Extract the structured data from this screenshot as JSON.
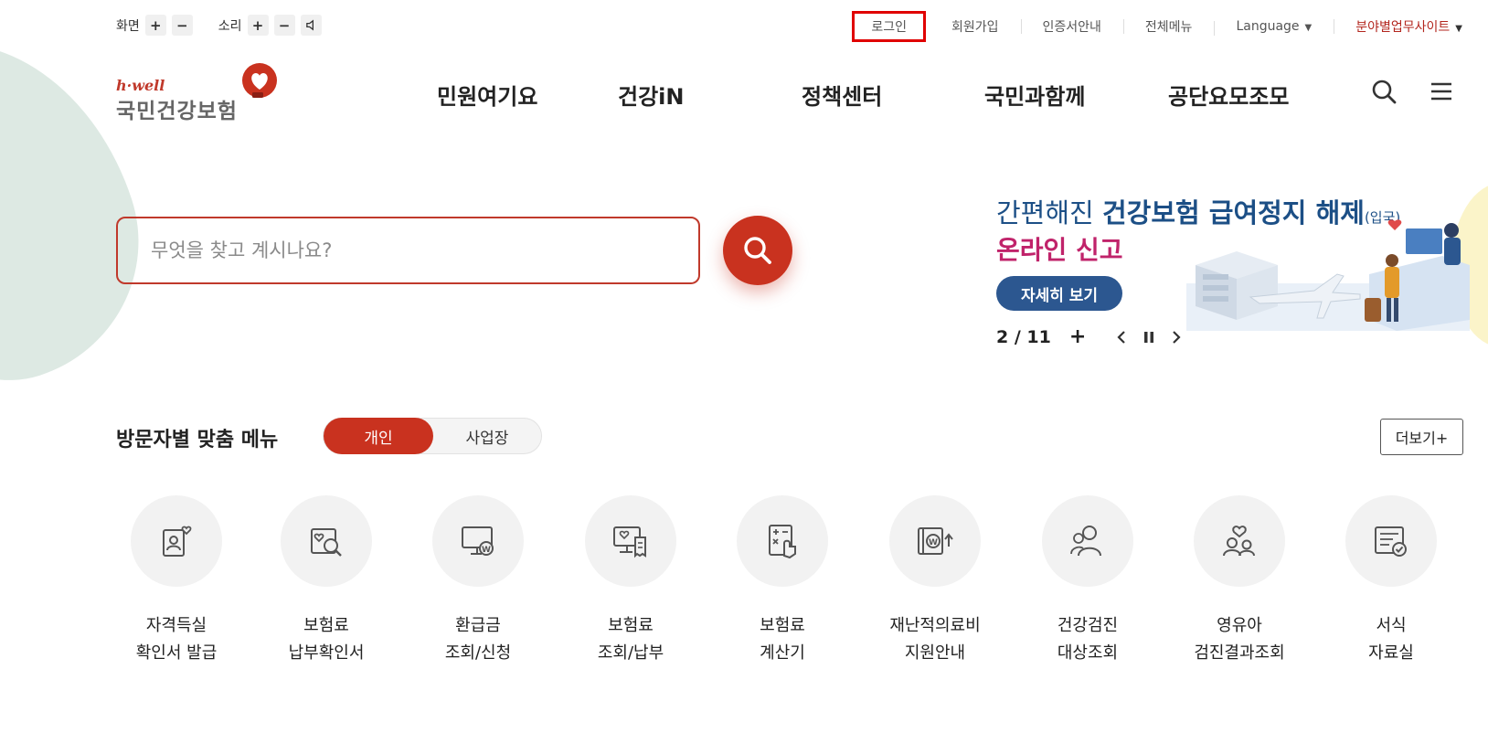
{
  "utility": {
    "screen_label": "화면",
    "sound_label": "소리",
    "plus": "+",
    "minus": "−",
    "links": {
      "login": "로그인",
      "signup": "회원가입",
      "cert": "인증서안내",
      "all_menu": "전체메뉴",
      "language": "Language",
      "field_sites": "분야별업무사이트"
    }
  },
  "logo": {
    "tagline": "h·well",
    "name": "국민건강보험"
  },
  "nav": {
    "items": [
      "민원여기요",
      "건강iN",
      "정책센터",
      "국민과함께",
      "공단요모조모"
    ]
  },
  "search": {
    "placeholder": "무엇을 찾고 계시나요?"
  },
  "banner": {
    "line1_light": "간편해진 ",
    "line1_bold": "건강보험 급여정지 해제",
    "line1_small": "(입국)",
    "line2": "온라인 신고",
    "button": "자세히 보기",
    "counter": "2 / 11",
    "plus": "+"
  },
  "visitor_menu": {
    "title": "방문자별 맞춤 메뉴",
    "tab_personal": "개인",
    "tab_business": "사업장",
    "more": "더보기+",
    "items": [
      {
        "line1": "자격득실",
        "line2": "확인서 발급",
        "icon": "certificate-heart-icon"
      },
      {
        "line1": "보험료",
        "line2": "납부확인서",
        "icon": "document-search-icon"
      },
      {
        "line1": "환급금",
        "line2": "조회/신청",
        "icon": "monitor-won-icon"
      },
      {
        "line1": "보험료",
        "line2": "조회/납부",
        "icon": "monitor-receipt-icon"
      },
      {
        "line1": "보험료",
        "line2": "계산기",
        "icon": "calculator-hand-icon"
      },
      {
        "line1": "재난적의료비",
        "line2": "지원안내",
        "icon": "won-card-arrow-icon"
      },
      {
        "line1": "건강검진",
        "line2": "대상조회",
        "icon": "people-group-icon"
      },
      {
        "line1": "영유아",
        "line2": "검진결과조회",
        "icon": "family-heart-icon"
      },
      {
        "line1": "서식",
        "line2": "자료실",
        "icon": "document-check-icon"
      }
    ]
  },
  "colors": {
    "brand_red": "#c9321f",
    "banner_blue": "#1c4f86",
    "banner_pink": "#c0236a"
  }
}
